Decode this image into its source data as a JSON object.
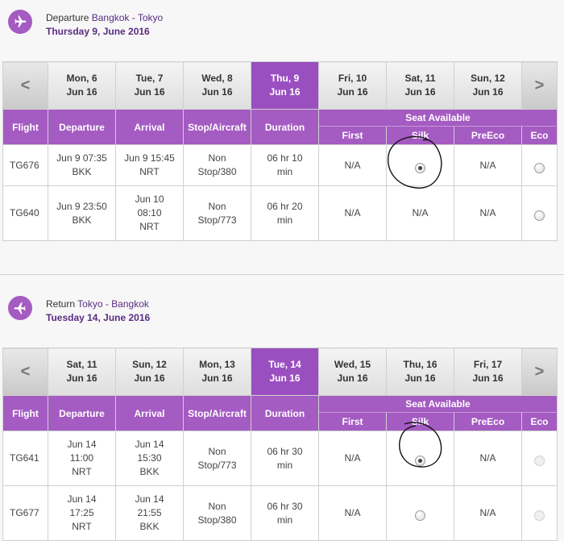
{
  "departure": {
    "label": "Departure",
    "cities": "Bangkok - Tokyo",
    "date": "Thursday 9, June 2016",
    "dates": [
      {
        "day": "Mon, 6",
        "month": "Jun 16"
      },
      {
        "day": "Tue, 7",
        "month": "Jun 16"
      },
      {
        "day": "Wed, 8",
        "month": "Jun 16"
      },
      {
        "day": "Thu, 9",
        "month": "Jun 16"
      },
      {
        "day": "Fri, 10",
        "month": "Jun 16"
      },
      {
        "day": "Sat, 11",
        "month": "Jun 16"
      },
      {
        "day": "Sun, 12",
        "month": "Jun 16"
      }
    ],
    "flights": [
      {
        "flight": "TG676",
        "dep1": "Jun 9 07:35",
        "dep2": "BKK",
        "dep3": "",
        "arr1": "Jun 9 15:45",
        "arr2": "NRT",
        "arr3": "",
        "stop1": "Non",
        "stop2": "Stop/380",
        "dur1": "06 hr 10",
        "dur2": "min",
        "first": "N/A",
        "silk": "",
        "preeco": "N/A"
      },
      {
        "flight": "TG640",
        "dep1": "Jun 9 23:50",
        "dep2": "BKK",
        "dep3": "",
        "arr1": "Jun 10",
        "arr2": "08:10",
        "arr3": "NRT",
        "stop1": "Non",
        "stop2": "Stop/773",
        "dur1": "06 hr 20",
        "dur2": "min",
        "first": "N/A",
        "silk": "N/A",
        "preeco": "N/A"
      }
    ]
  },
  "return": {
    "label": "Return",
    "cities": "Tokyo - Bangkok",
    "date": "Tuesday 14, June 2016",
    "dates": [
      {
        "day": "Sat, 11",
        "month": "Jun 16"
      },
      {
        "day": "Sun, 12",
        "month": "Jun 16"
      },
      {
        "day": "Mon, 13",
        "month": "Jun 16"
      },
      {
        "day": "Tue, 14",
        "month": "Jun 16"
      },
      {
        "day": "Wed, 15",
        "month": "Jun 16"
      },
      {
        "day": "Thu, 16",
        "month": "Jun 16"
      },
      {
        "day": "Fri, 17",
        "month": "Jun 16"
      }
    ],
    "flights": [
      {
        "flight": "TG641",
        "dep1": "Jun 14",
        "dep2": "11:00",
        "dep3": "NRT",
        "arr1": "Jun 14",
        "arr2": "15:30",
        "arr3": "BKK",
        "stop1": "Non",
        "stop2": "Stop/773",
        "dur1": "06 hr 30",
        "dur2": "min",
        "first": "N/A",
        "silk": "",
        "preeco": "N/A"
      },
      {
        "flight": "TG677",
        "dep1": "Jun 14",
        "dep2": "17:25",
        "dep3": "NRT",
        "arr1": "Jun 14",
        "arr2": "21:55",
        "arr3": "BKK",
        "stop1": "Non",
        "stop2": "Stop/380",
        "dur1": "06 hr 30",
        "dur2": "min",
        "first": "N/A",
        "silk": "",
        "preeco": "N/A"
      }
    ]
  },
  "columns": {
    "flight": "Flight",
    "departure": "Departure",
    "arrival": "Arrival",
    "stop": "Stop/Aircraft",
    "duration": "Duration",
    "seat_available": "Seat Available",
    "first": "First",
    "silk": "Silk",
    "preeco": "PreEco",
    "eco": "Eco"
  },
  "nav": {
    "prev": "<",
    "next": ">"
  },
  "colors": {
    "brand_purple": "#a45bc2",
    "selected_date": "#9a4fc0",
    "route_text": "#5a2d82"
  },
  "icons": {
    "route": "airplane-icon"
  },
  "selection": {
    "departure": {
      "flight": "TG676",
      "fare": "Silk"
    },
    "return": {
      "flight": "TG641",
      "fare": "Silk"
    }
  }
}
